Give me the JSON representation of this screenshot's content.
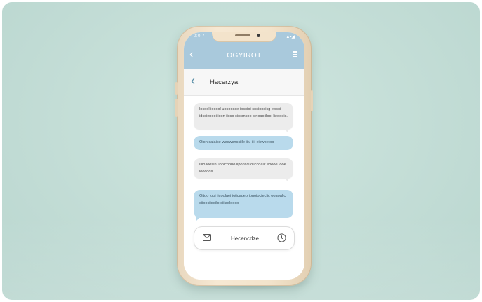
{
  "status_bar": {
    "time": "0:0 7",
    "icons": "▲▪◢"
  },
  "app_bar": {
    "title": "OGYIROT",
    "back_icon": "chevron-left-icon",
    "menu_icon": "hamburger-menu-icon"
  },
  "conversation": {
    "title": "Hacerzya",
    "back_icon": "chevron-left-icon"
  },
  "messages": [
    {
      "direction": "incoming",
      "text": "locool iocool uocoosce iocoioi cocioosicg eocoi idccienooi iocn iicco ciocmcoo cinoaolilool lieooeis."
    },
    {
      "direction": "outgoing",
      "text": "Oion caiaice weewsnsciile iiiu ilii eicwoeloo"
    },
    {
      "direction": "incoming",
      "text": "Iiiio ioosini iooicoouo iiponsci oiiccoaic eoooe iooe ioocoos."
    },
    {
      "direction": "outgoing",
      "text": "Oitoo iooi iicoolaei ioiicadeo ionoiocieclic ooaoalic ciioociiddilo ciiiaolooco"
    }
  ],
  "composer": {
    "label": "Hecencdze",
    "left_icon": "mail-icon",
    "right_icon": "clock-icon"
  },
  "colors": {
    "background": "#c3ddd6",
    "phone_frame": "#f3e3cb",
    "app_bar": "#a9c9dc",
    "incoming_bubble": "#ececec",
    "outgoing_bubble": "#b9daec",
    "accent": "#5a8fa8"
  }
}
